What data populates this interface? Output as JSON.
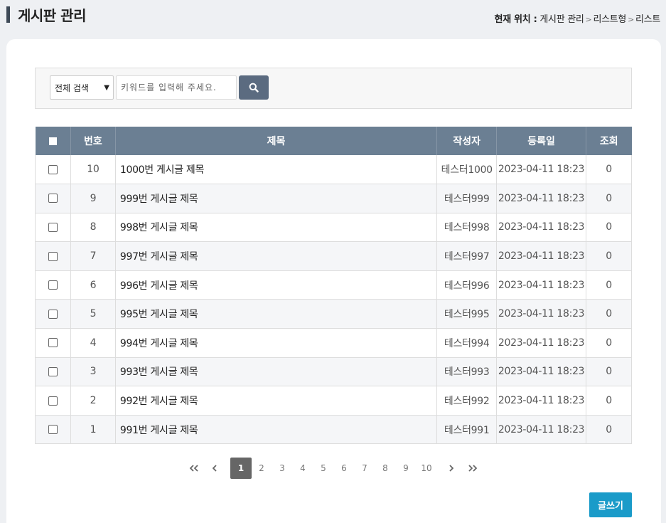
{
  "header": {
    "title": "게시판 관리",
    "breadcrumb_label": "현재 위치 :",
    "breadcrumb": [
      "게시판 관리",
      "리스트형",
      "리스트"
    ],
    "separator": ">"
  },
  "search": {
    "select_value": "전체 검색",
    "placeholder": "키워드를 입력해 주세요."
  },
  "table": {
    "headers": [
      "번호",
      "제목",
      "작성자",
      "등록일",
      "조회"
    ],
    "rows": [
      {
        "no": "10",
        "title": "1000번 게시글 제목",
        "author": "테스터1000",
        "date": "2023-04-11 18:23",
        "views": "0"
      },
      {
        "no": "9",
        "title": "999번 게시글 제목",
        "author": "테스터999",
        "date": "2023-04-11 18:23",
        "views": "0"
      },
      {
        "no": "8",
        "title": "998번 게시글 제목",
        "author": "테스터998",
        "date": "2023-04-11 18:23",
        "views": "0"
      },
      {
        "no": "7",
        "title": "997번 게시글 제목",
        "author": "테스터997",
        "date": "2023-04-11 18:23",
        "views": "0"
      },
      {
        "no": "6",
        "title": "996번 게시글 제목",
        "author": "테스터996",
        "date": "2023-04-11 18:23",
        "views": "0"
      },
      {
        "no": "5",
        "title": "995번 게시글 제목",
        "author": "테스터995",
        "date": "2023-04-11 18:23",
        "views": "0"
      },
      {
        "no": "4",
        "title": "994번 게시글 제목",
        "author": "테스터994",
        "date": "2023-04-11 18:23",
        "views": "0"
      },
      {
        "no": "3",
        "title": "993번 게시글 제목",
        "author": "테스터993",
        "date": "2023-04-11 18:23",
        "views": "0"
      },
      {
        "no": "2",
        "title": "992번 게시글 제목",
        "author": "테스터992",
        "date": "2023-04-11 18:23",
        "views": "0"
      },
      {
        "no": "1",
        "title": "991번 게시글 제목",
        "author": "테스터991",
        "date": "2023-04-11 18:23",
        "views": "0"
      }
    ]
  },
  "pagination": {
    "first": "«",
    "prev": "‹",
    "pages": [
      "1",
      "2",
      "3",
      "4",
      "5",
      "6",
      "7",
      "8",
      "9",
      "10"
    ],
    "current": "1",
    "next": "›",
    "last": "»"
  },
  "write_button": "글쓰기",
  "colors": {
    "header_bg": "#6b7f93",
    "search_button": "#5b6b80",
    "write_button": "#1a9bc9",
    "active_page": "#666666"
  }
}
